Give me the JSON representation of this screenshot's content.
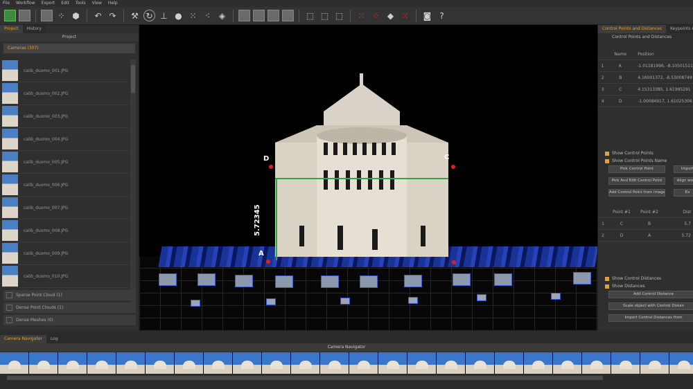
{
  "menu": [
    "File",
    "Workflow",
    "Export",
    "Edit",
    "Tools",
    "View",
    "Help"
  ],
  "toolbar": {
    "icons": [
      "project-icon",
      "save-icon",
      "grid-icon",
      "points-icon",
      "mesh-icon",
      "undo-icon",
      "redo-icon",
      "tools-icon",
      "rotate-icon",
      "axis-icon",
      "light-icon",
      "dense-icon",
      "sparse-icon",
      "cube-icon",
      "render1-icon",
      "render2-icon",
      "render3-icon",
      "render4-icon",
      "select1-icon",
      "select2-icon",
      "select3-icon",
      "cp1-icon",
      "cp2-icon",
      "cp3-icon",
      "cp4-icon",
      "screenshot-icon",
      "help-icon"
    ]
  },
  "left_panel": {
    "tabs": [
      "Project",
      "History"
    ],
    "title": "Project",
    "cameras_group": "Cameras (307)",
    "cameras": [
      "calib_duomo_001.JPG",
      "calib_duomo_002.JPG",
      "calib_duomo_003.JPG",
      "calib_duomo_004.JPG",
      "calib_duomo_005.JPG",
      "calib_duomo_006.JPG",
      "calib_duomo_007.JPG",
      "calib_duomo_008.JPG",
      "calib_duomo_009.JPG",
      "calib_duomo_010.JPG"
    ],
    "bottom_groups": [
      "Sparse Point Cloud (1)",
      "Dense Point Clouds (1)",
      "Dense Meshes (0)"
    ]
  },
  "viewport": {
    "control_points": {
      "A": "A",
      "B": "B",
      "C": "C",
      "D": "D"
    },
    "measurement": "5.72345"
  },
  "right_panel": {
    "tabs": [
      "Control Points and Distances",
      "Keypoints And"
    ],
    "title": "Control Points and Distances",
    "cp_headers": [
      "",
      "Name",
      "Position"
    ],
    "cp_rows": [
      [
        "1",
        "A",
        "-1.01181996, -8.10501511"
      ],
      [
        "2",
        "B",
        "4.16001372, -8.53008749"
      ],
      [
        "3",
        "C",
        "4.15313385, 1.61995291"
      ],
      [
        "4",
        "D",
        "-1.00084917, 1.61025306"
      ]
    ],
    "checks1": [
      "Show Control Points",
      "Show Control Points Name"
    ],
    "buttons1": [
      "Pick Control Point",
      "Import",
      "Pick And Edit Control Point",
      "Align world",
      "Add Control Point from images",
      "Ex"
    ],
    "dist_headers": [
      "",
      "Point #1",
      "Point #2",
      "Dist"
    ],
    "dist_rows": [
      [
        "1",
        "C",
        "B",
        "5.7"
      ],
      [
        "2",
        "D",
        "A",
        "5.72"
      ]
    ],
    "checks2": [
      "Show Control Distances",
      "Show Distances"
    ],
    "buttons2": [
      "Add Control Distance",
      "Scale object with Control Distan",
      "Import Control Distances from"
    ]
  },
  "bottom": {
    "tabs": [
      "Camera Navigator",
      "Log"
    ],
    "navigator_title": "Camera Navigator",
    "frame_count": 24
  }
}
